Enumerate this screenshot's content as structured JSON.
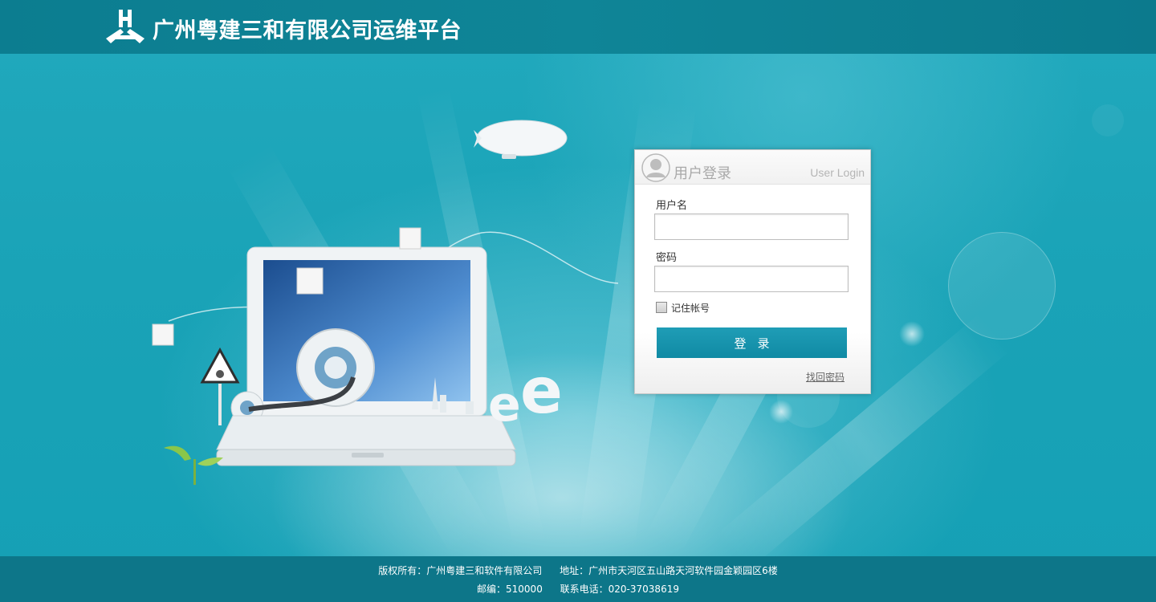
{
  "header": {
    "title": "广州粤建三和有限公司运维平台",
    "logo": "H-logo-icon"
  },
  "login": {
    "title": "用户登录",
    "subtitle": "User Login",
    "username_label": "用户名",
    "username_value": "",
    "password_label": "密码",
    "password_value": "",
    "remember_label": "记住帐号",
    "remember_checked": false,
    "submit_label": "登录",
    "forgot_label": "找回密码"
  },
  "footer": {
    "copyright": "版权所有：广州粤建三和软件有限公司",
    "address": "地址：广州市天河区五山路天河软件园金颖园区6楼",
    "postcode": "邮编：510000",
    "phone": "联系电话：020-37038619"
  },
  "colors": {
    "header_bg": "#0d7f92",
    "page_bg": "#1aa3b7",
    "button_bg": "#1596b0",
    "footer_bg": "#0d7689"
  }
}
